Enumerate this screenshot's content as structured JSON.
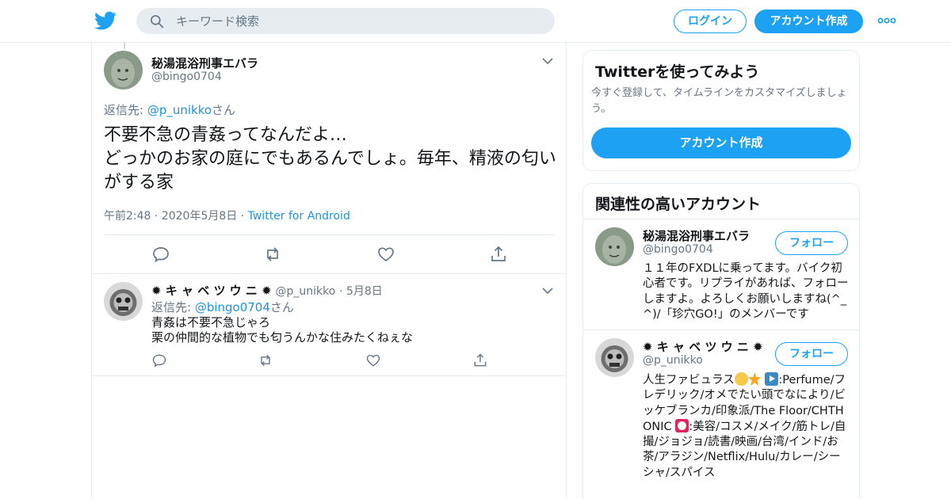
{
  "header": {
    "logo_icon": "twitter-bird-icon",
    "search_placeholder": "キーワード検索",
    "login_label": "ログイン",
    "signup_label": "アカウント作成",
    "more_icon": "more-dots-icon"
  },
  "colors": {
    "accent": "#1da1f2",
    "link": "#1b95e0",
    "secondary_text": "#657786",
    "border": "#e6ecf0"
  },
  "main_tweet": {
    "name": "秘湯混浴刑事エバラ",
    "handle": "@bingo0704",
    "reply_prefix": "返信先: ",
    "reply_user": "@p_unikko",
    "reply_suffix": "さん",
    "text": "不要不急の青姦ってなんだよ…\nどっかのお家の庭にでもあるんでしょ。毎年、精液の匂いがする家",
    "time": "午前2:48",
    "date": "2020年5月8日",
    "source": "Twitter for Android"
  },
  "reply_tweet": {
    "name": "✹ キ ャ ベ ツ ウ ニ ✹",
    "handle": "@p_unikko",
    "date": "5月8日",
    "reply_prefix": "返信先: ",
    "reply_user": "@bingo0704",
    "reply_suffix": "さん",
    "text": "青姦は不要不急じゃろ\n栗の仲間的な植物でも匂うんかな住みたくねぇな"
  },
  "sidebar": {
    "signup_card": {
      "title": "Twitterを使ってみよう",
      "description": "今すぐ登録して、タイムラインをカスタマイズしましょう。",
      "button_label": "アカウント作成"
    },
    "related": {
      "title": "関連性の高いアカウント",
      "follow_label": "フォロー",
      "accounts": [
        {
          "name": "秘湯混浴刑事エバラ",
          "handle": "@bingo0704",
          "bio": "１１年のFXDLに乗ってます。バイク初心者です。リプライがあれば、フォローしますよ。よろしくお願いしますね(^_^)/「珍穴GO!」のメンバーです"
        },
        {
          "name": "✹ キ ャ ベ ツ ウ ニ ✹",
          "handle": "@p_unikko",
          "bio_part1": "人生ファビュラス",
          "bio_part2": ":Perfume/フレデリック/オメでたい頭でなにより/ビッケブランカ/印象派/The Floor/CHTHONIC ",
          "bio_part3": ":美容/コスメ/メイク/筋トレ/自撮/ジョジョ/読書/映画/台湾/インド/お茶/アラジン/Netflix/Hulu/カレー/シーシャ/スパイス"
        }
      ]
    }
  }
}
